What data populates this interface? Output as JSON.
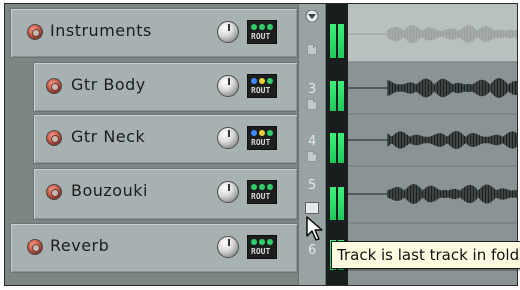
{
  "tracks": [
    {
      "name": "Instruments",
      "number": ""
    },
    {
      "name": "Gtr Body",
      "number": "3"
    },
    {
      "name": "Gtr Neck",
      "number": "4"
    },
    {
      "name": "Bouzouki",
      "number": "5"
    },
    {
      "name": "Reverb",
      "number": "6"
    }
  ],
  "route_button_label": "ROUT",
  "tooltip": "Track is last track in folde",
  "colors": {
    "meter_green": "#2fe06d",
    "panel": "#a8b1b2",
    "tooltip_bg": "#fffbe1"
  }
}
